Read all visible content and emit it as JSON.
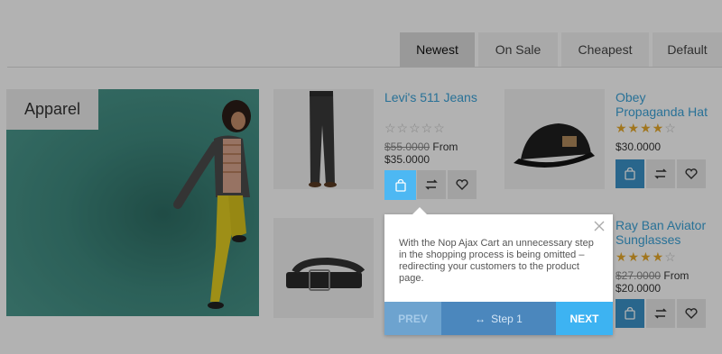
{
  "sort_tabs": [
    {
      "label": "Newest"
    },
    {
      "label": "On Sale"
    },
    {
      "label": "Cheapest"
    },
    {
      "label": "Default"
    }
  ],
  "banner": {
    "label": "Apparel"
  },
  "products": [
    {
      "title": "Levi's 511 Jeans",
      "rating": 0,
      "old_price": "$55.0000",
      "from_label": "From",
      "price": "$35.0000"
    },
    {
      "title": "Obey Propaganda Hat",
      "rating": 4,
      "price": "$30.0000"
    },
    {
      "title": "Ray Ban Aviator Sunglasses",
      "rating": 4,
      "old_price": "$27.0000",
      "from_label": "From",
      "price": "$20.0000"
    }
  ],
  "tooltip": {
    "text": "With the Nop Ajax Cart an unnecessary step in the shopping process is being omitted – redirecting your customers to the product page.",
    "prev_label": "PREV",
    "step_label": "Step 1",
    "next_label": "NEXT"
  },
  "icons": {
    "cart": "shopping-bag-icon",
    "compare": "compare-arrows-icon",
    "wishlist": "heart-icon",
    "close": "close-icon",
    "step": "dots-icon"
  },
  "colors": {
    "accent": "#3b93c9",
    "highlight": "#4db8f3",
    "link": "#3aa2d8",
    "star": "#e7a92c"
  }
}
